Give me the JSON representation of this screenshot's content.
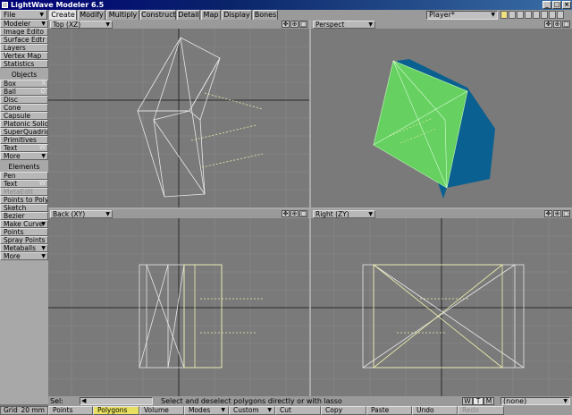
{
  "window": {
    "title": "LightWave Modeler 6.5",
    "buttons": [
      "_",
      "□",
      "×"
    ]
  },
  "top_tabs": [
    "Create",
    "Modify",
    "Multiply",
    "Construct",
    "Detail",
    "Map",
    "Display",
    "Bones"
  ],
  "active_tab": "Create",
  "file_menu": "File",
  "player": "Player*",
  "left_panel": {
    "items": [
      {
        "label": "Modeler",
        "type": "drop"
      },
      {
        "label": "Image Edito",
        "type": "btn"
      },
      {
        "label": "Surface Edtr",
        "type": "btn"
      },
      {
        "label": "Layers",
        "type": "btn"
      },
      {
        "label": "Vertex Map",
        "type": "btn"
      },
      {
        "label": "Statistics",
        "type": "btn"
      }
    ],
    "objects_header": "Objects",
    "objects": [
      {
        "label": "Box",
        "key": "X"
      },
      {
        "label": "Ball",
        "key": "O"
      },
      {
        "label": "Disc",
        "key": ""
      },
      {
        "label": "Cone",
        "key": ""
      },
      {
        "label": "Capsule",
        "key": ""
      },
      {
        "label": "Platonic Solid",
        "key": ""
      },
      {
        "label": "SuperQuadric",
        "key": ""
      },
      {
        "label": "Primitives",
        "key": ""
      },
      {
        "label": "Text",
        "key": "W"
      },
      {
        "label": "More",
        "key": ""
      }
    ],
    "elements_header": "Elements",
    "elements": [
      {
        "label": "Pen",
        "key": ""
      },
      {
        "label": "Text",
        "key": "W"
      },
      {
        "label": "MetaEdit",
        "key": ""
      },
      {
        "label": "Points to Polys",
        "key": ""
      },
      {
        "label": "Sketch",
        "key": ""
      },
      {
        "label": "Bezier",
        "key": ""
      },
      {
        "label": "Make Curve",
        "key": ""
      },
      {
        "label": "Points",
        "key": ""
      },
      {
        "label": "Spray Points",
        "key": ""
      },
      {
        "label": "Metaballs",
        "key": ""
      },
      {
        "label": "More",
        "key": ""
      }
    ]
  },
  "viewports": [
    {
      "name": "Top (XZ)"
    },
    {
      "name": "Perspect"
    },
    {
      "name": "Back (XY)"
    },
    {
      "name": "Right (ZY)"
    }
  ],
  "status": {
    "sel_label": "Sel:",
    "hint": "Select and deselect polygons directly or with lasso",
    "wtm": [
      "W",
      "T",
      "M"
    ],
    "wtm_active": "T",
    "surface": "(none)"
  },
  "bottom": {
    "grid_label": "Grid",
    "grid_value": "20 mm",
    "modes": [
      "Points",
      "Polygons",
      "Volume",
      "Modes",
      "Custom",
      "Cut",
      "Copy",
      "Paste",
      "Undo",
      "Redo"
    ],
    "active_mode": "Polygons"
  },
  "colors": {
    "green_face": "#66d060",
    "blue_face": "#0a6090",
    "wire": "#e8e8e8",
    "wire_yellow": "#f0f0b0"
  }
}
